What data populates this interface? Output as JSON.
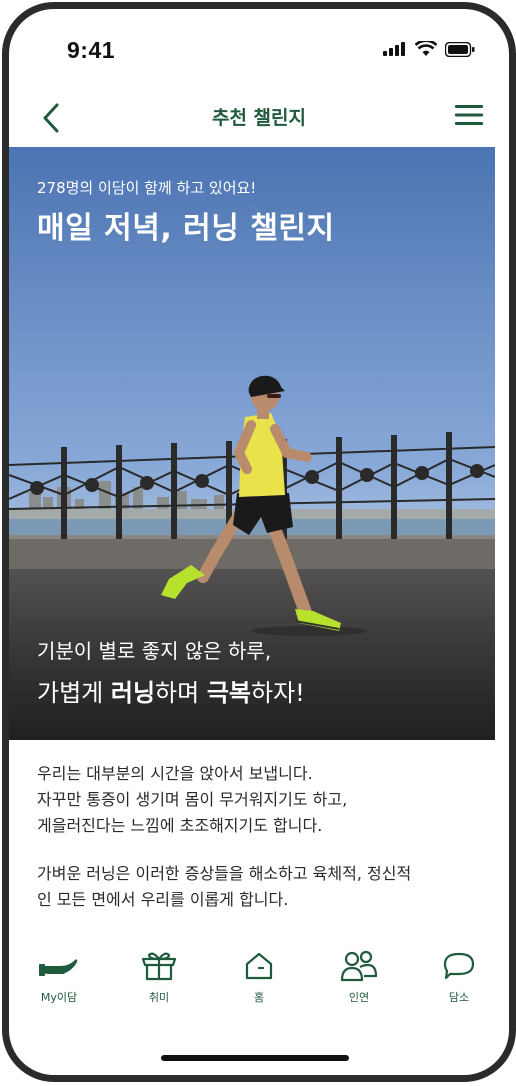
{
  "status_bar": {
    "time": "9:41"
  },
  "nav": {
    "title": "추천 챌린지"
  },
  "hero": {
    "subtitle": "278명의 이담이 함께 하고 있어요!",
    "title": "매일 저녁, 러닝 챌린지",
    "caption_line1": "기분이 별로 좋지 않은 하루,",
    "caption_line2_part1": "가볍게 ",
    "caption_line2_bold1": "러닝",
    "caption_line2_part2": "하며 ",
    "caption_line2_bold2": "극복",
    "caption_line2_part3": "하자!"
  },
  "body": {
    "paragraph1_line1": "우리는 대부분의 시간을 앉아서 보냅니다.",
    "paragraph1_line2": "자꾸만 통증이 생기며 몸이 무거워지기도 하고,",
    "paragraph1_line3": "게을러진다는 느낌에 초조해지기도 합니다.",
    "paragraph2_line1": "가벼운 러닝은 이러한 증상들을 해소하고 육체적, 정신적",
    "paragraph2_line2": "인 모든 면에서 우리를 이롭게 합니다."
  },
  "tabbar": {
    "items": [
      {
        "label": "My이담",
        "icon": "hand-icon"
      },
      {
        "label": "취미",
        "icon": "gift-box-icon"
      },
      {
        "label": "홈",
        "icon": "home-icon"
      },
      {
        "label": "인연",
        "icon": "people-icon"
      },
      {
        "label": "담소",
        "icon": "chat-bubble-icon"
      }
    ]
  },
  "colors": {
    "accent": "#1f5a3c",
    "sky_top": "#4c74b3",
    "sky_bottom": "#bcd0ea",
    "road": "#3f3d3d"
  }
}
